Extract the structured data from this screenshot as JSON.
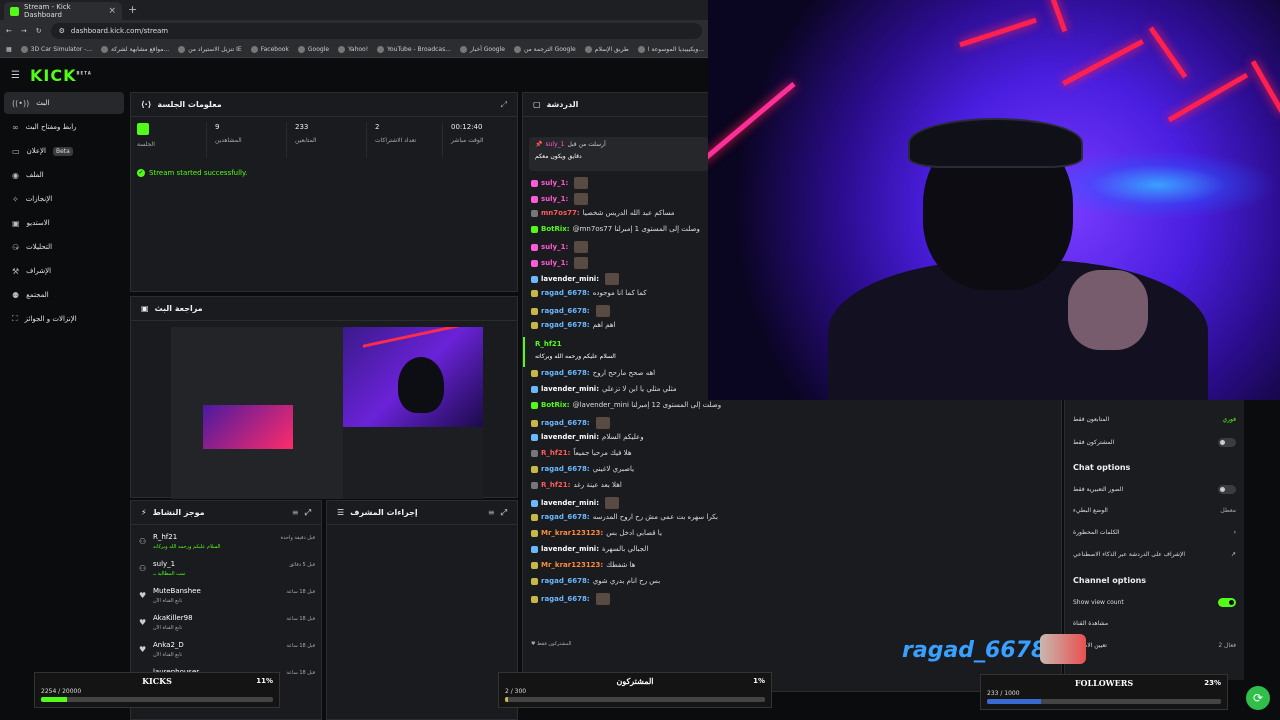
{
  "browser": {
    "tab_title": "Stream - Kick Dashboard",
    "url": "dashboard.kick.com/stream",
    "bookmarks": [
      "3D Car Simulator -...",
      "مواقع مشابهة لشركة...",
      "تنزيل الاستيراد من IE",
      "Facebook",
      "Google",
      "Yahoo!",
      "YouTube - Broadcas...",
      "أخبار Google",
      "الترجمة من Google",
      "طريق الإسلام",
      "ويكيبيديا الموسوعة ا..."
    ]
  },
  "logo": "KICK",
  "logo_beta": "BETA",
  "sidebar": {
    "items": [
      {
        "label": "البث",
        "icon": "broadcast-icon"
      },
      {
        "label": "رابط ومفتاح البث",
        "icon": "link-icon"
      },
      {
        "label": "الإعلان",
        "icon": "ad-icon",
        "badge": "Beta"
      },
      {
        "label": "الملف",
        "icon": "profile-icon"
      },
      {
        "label": "الإنجازات",
        "icon": "achievements-icon"
      },
      {
        "label": "الاستديو",
        "icon": "studio-icon"
      },
      {
        "label": "التحليلات",
        "icon": "analytics-icon"
      },
      {
        "label": "الإشراف",
        "icon": "moderation-icon"
      },
      {
        "label": "المجتمع",
        "icon": "community-icon"
      },
      {
        "label": "الإنزالات و الجوائز",
        "icon": "drops-icon"
      }
    ]
  },
  "session": {
    "title": "معلومات الجلسة",
    "stats": [
      {
        "value": "",
        "label": "الجلسة"
      },
      {
        "value": "9",
        "label": "المشاهدين"
      },
      {
        "value": "233",
        "label": "المتابعين"
      },
      {
        "value": "2",
        "label": "تعداد الاشتراكات"
      },
      {
        "value": "00:12:40",
        "label": "الوقت مباشر"
      }
    ],
    "success": "Stream started successfully."
  },
  "review": {
    "title": "مراجعة البث"
  },
  "activity": {
    "title": "موجز النشاط",
    "items": [
      {
        "user": "R_hf21",
        "desc": "السلام عليكم ورحمه الله وبركاته",
        "time": "قبل دقيقة واحدة"
      },
      {
        "user": "suly_1",
        "desc": "تمت المطالبة بـ",
        "time": "قبل 5 دقائق"
      },
      {
        "user": "MuteBanshee",
        "desc": "تابع القناة الآن",
        "time": "قبل 18 ساعة"
      },
      {
        "user": "AkaKiller98",
        "desc": "تابع القناة الآن",
        "time": "قبل 18 ساعة"
      },
      {
        "user": "Anka2_D",
        "desc": "تابع القناة الآن",
        "time": "قبل 18 ساعة"
      },
      {
        "user": "laurenhouser",
        "desc": "",
        "time": "قبل 18 ساعة"
      }
    ]
  },
  "modactions": {
    "title": "إجراءات المشرف"
  },
  "chat": {
    "title": "الدردشة",
    "pinned": {
      "user": "suly_1",
      "text": "أرسلت من قبل",
      "body": "دقايق ويكون معكم"
    },
    "messages": [
      {
        "user": "suly_1",
        "text": "",
        "color": "pink"
      },
      {
        "user": "suly_1",
        "text": "",
        "color": "pink"
      },
      {
        "user": "mn7os77",
        "text": "مساكم عبد الله الدريس شخصيا",
        "color": "red"
      },
      {
        "user": "BotRix",
        "text": "@mn7os77 وصلت إلى المستوى 1 إمبرلنا",
        "color": "green"
      },
      {
        "user": "suly_1",
        "text": "",
        "color": "pink"
      },
      {
        "user": "suly_1",
        "text": "",
        "color": "pink"
      },
      {
        "user": "lavender_mini",
        "text": "",
        "color": "white"
      },
      {
        "user": "ragad_6678",
        "text": "كما كما انا موجوده",
        "color": "blue"
      },
      {
        "user": "ragad_6678",
        "text": "",
        "color": "blue"
      },
      {
        "user": "ragad_6678",
        "text": "اهم اهم",
        "color": "blue"
      },
      {
        "user": "R_hf21",
        "text": "السلام عليكم ورحمه الله وبركاته",
        "color": "green"
      },
      {
        "user": "ragad_6678",
        "text": "اهه صحح مارحح اروح",
        "color": "blue"
      },
      {
        "user": "lavender_mini",
        "text": "مثلي مثلي يا ابن لا تزعلي",
        "color": "white"
      },
      {
        "user": "BotRix",
        "text": "@lavender_mini وصلت إلى المستوى 12 إمبرلنا",
        "color": "green"
      },
      {
        "user": "ragad_6678",
        "text": "",
        "color": "blue"
      },
      {
        "user": "lavender_mini",
        "text": "وعليكم السلام",
        "color": "white"
      },
      {
        "user": "R_hf21",
        "text": "هلا فيك مرحبا جميعاً",
        "color": "red"
      },
      {
        "user": "ragad_6678",
        "text": "ياصبري لاغيني",
        "color": "blue"
      },
      {
        "user": "R_hf21",
        "text": "اهلا بعد عينة رغد",
        "color": "red"
      },
      {
        "user": "lavender_mini",
        "text": "",
        "color": "white"
      },
      {
        "user": "ragad_6678",
        "text": "بكرا سهره بت عمي مش رح اروح المدرسه",
        "color": "blue"
      },
      {
        "user": "Mr_krar123123",
        "text": "يا قصابي ادخل بس",
        "color": "orange"
      },
      {
        "user": "lavender_mini",
        "text": "الجبالي بالسهرة",
        "color": "white"
      },
      {
        "user": "Mr_krar123123",
        "text": "ها شفطك",
        "color": "orange"
      },
      {
        "user": "ragad_6678",
        "text": "بس رح انام بدري شوي",
        "color": "blue"
      },
      {
        "user": "ragad_6678",
        "text": "",
        "color": "blue"
      }
    ]
  },
  "settings": {
    "followers_only": "المتابعون فقط",
    "followers_value": "فوري",
    "subscribers_only": "المشتركون فقط",
    "chat_options": "Chat options",
    "emote_only": "الصور التعبيرية فقط",
    "slow_mode": "الوضع البطيء",
    "slow_value": "معطل",
    "banned_words": "الكلمات المحظورة",
    "ai_moderation": "الإشراف على الدردشة عبر الذكاء الاصطناعي",
    "channel_options": "Channel options",
    "show_view_count": "Show view count",
    "channel_share": "مشاهدة القناة",
    "host_label": "تعيين الاهداف",
    "host_value": "فعال 2"
  },
  "goals": {
    "kicks": {
      "title": "KICKS",
      "count": "2254 / 20000",
      "percent": "11%",
      "fraction": 0.11,
      "color": "#53fc18"
    },
    "subs": {
      "title": "المشتركون",
      "count": "2 / 300",
      "percent": "1%",
      "fraction": 0.01,
      "color": "#c8b84a"
    },
    "followers": {
      "title": "FOLLOWERS",
      "count": "233 / 1000",
      "percent": "23%",
      "fraction": 0.23,
      "color": "#3a6ad0"
    }
  },
  "overlay_name": "ragad_6678"
}
